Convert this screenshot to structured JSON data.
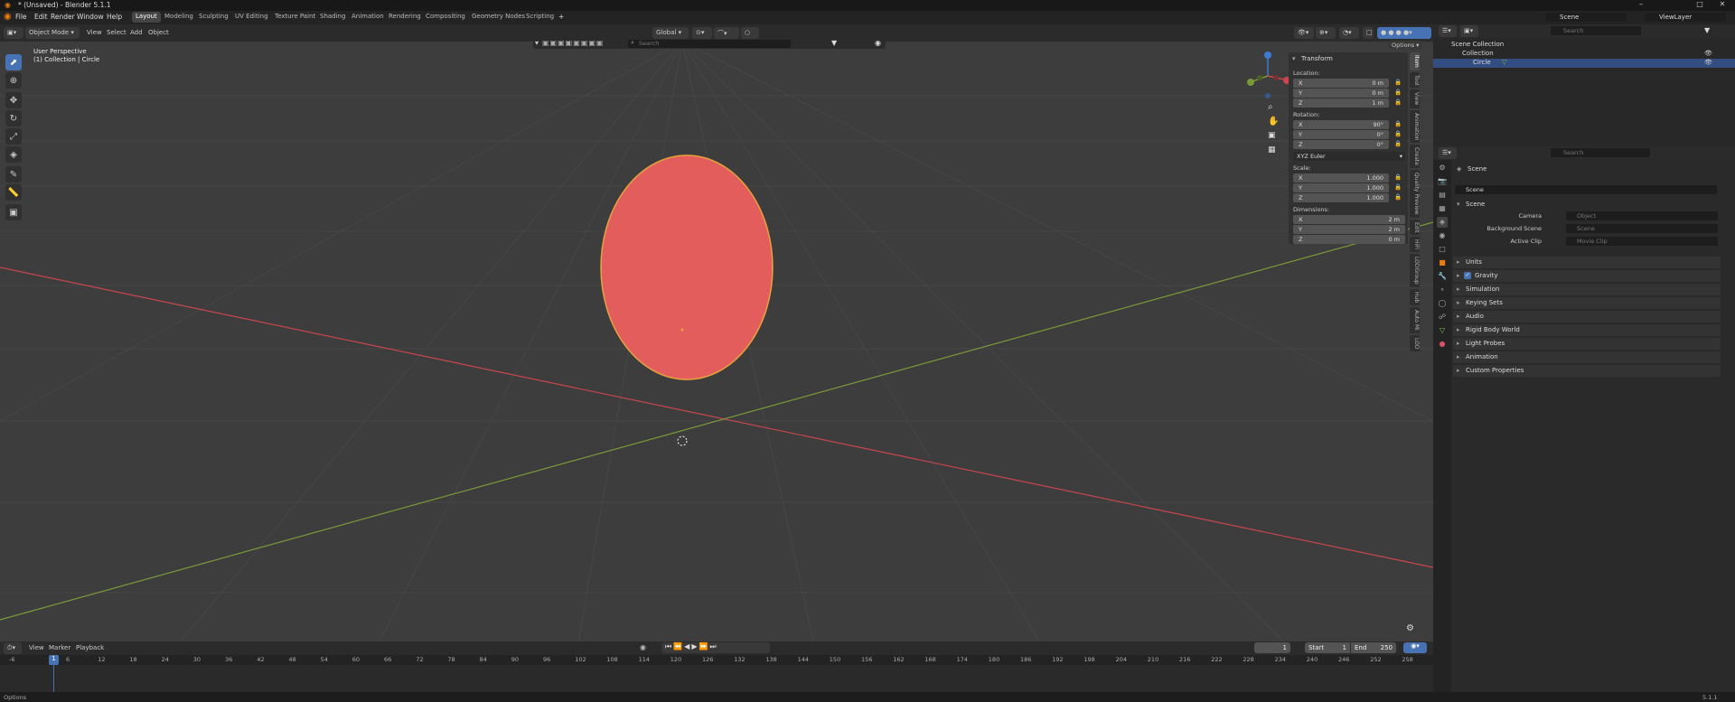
{
  "window": {
    "title": "* (Unsaved) - Blender 5.1.1",
    "controls": [
      "–",
      "□",
      "✕"
    ]
  },
  "menus": [
    "File",
    "Edit",
    "Render",
    "Window",
    "Help"
  ],
  "workspaces": [
    "Layout",
    "Modeling",
    "Sculpting",
    "UV Editing",
    "Texture Paint",
    "Shading",
    "Animation",
    "Rendering",
    "Compositing",
    "Geometry Nodes",
    "Scripting"
  ],
  "add_workspace": "+",
  "scene_field": "Scene",
  "viewlayer_field": "ViewLayer",
  "viewport_header": {
    "mode": "Object Mode",
    "menus": [
      "View",
      "Select",
      "Add",
      "Object"
    ],
    "orientation": "Global",
    "search_placeholder": "Search",
    "options": "Options"
  },
  "viewport": {
    "perspective": "User Perspective",
    "collection_path": "(1) Collection | Circle",
    "circle_color": "#e35d5d",
    "outline_color": "#e9a23b",
    "x_axis_color": "#c9464e",
    "y_axis_color": "#7a9a3a"
  },
  "transform": {
    "title": "Transform",
    "location_label": "Location:",
    "location": [
      {
        "axis": "X",
        "value": "0 m"
      },
      {
        "axis": "Y",
        "value": "0 m"
      },
      {
        "axis": "Z",
        "value": "1 m"
      }
    ],
    "rotation_label": "Rotation:",
    "rotation": [
      {
        "axis": "X",
        "value": "90°"
      },
      {
        "axis": "Y",
        "value": "0°"
      },
      {
        "axis": "Z",
        "value": "0°"
      }
    ],
    "rotation_mode": "XYZ Euler",
    "scale_label": "Scale:",
    "scale": [
      {
        "axis": "X",
        "value": "1.000"
      },
      {
        "axis": "Y",
        "value": "1.000"
      },
      {
        "axis": "Z",
        "value": "1.000"
      }
    ],
    "dimensions_label": "Dimensions:",
    "dimensions": [
      {
        "axis": "X",
        "value": "2 m"
      },
      {
        "axis": "Y",
        "value": "2 m"
      },
      {
        "axis": "Z",
        "value": "0 m"
      }
    ]
  },
  "side_tabs": [
    "Item",
    "Tool",
    "View",
    "Animation",
    "Create",
    "Quality Preview",
    "Edit",
    "HiFi",
    "LODGroup",
    "Hub",
    "Auto Mi",
    "LOD"
  ],
  "timeline": {
    "menus": [
      "View",
      "Marker",
      "Playback"
    ],
    "current_frame": "1",
    "start_label": "Start",
    "start": "1",
    "end_label": "End",
    "end": "250",
    "ruler": [
      "-6",
      "1",
      "6",
      "12",
      "18",
      "24",
      "30",
      "36",
      "42",
      "48",
      "54",
      "60",
      "66",
      "72",
      "78",
      "84",
      "90",
      "96",
      "102",
      "108",
      "114",
      "120",
      "126",
      "132",
      "138",
      "144",
      "150",
      "156",
      "162",
      "168",
      "174",
      "180",
      "186",
      "192",
      "198",
      "204",
      "210",
      "216",
      "222",
      "228",
      "234",
      "240",
      "246",
      "252",
      "258"
    ]
  },
  "outliner": {
    "search_placeholder": "Search",
    "items": [
      "Scene Collection",
      "Collection",
      "Circle"
    ]
  },
  "properties": {
    "search_placeholder": "Search",
    "breadcrumb": "Scene",
    "scene_name": "Scene",
    "section_scene": "Scene",
    "camera_label": "Camera",
    "camera_placeholder": "Object",
    "background_label": "Background Scene",
    "background_placeholder": "Scene",
    "clip_label": "Active Clip",
    "clip_placeholder": "Movie Clip",
    "sections": [
      "Units",
      "Gravity",
      "Simulation",
      "Keying Sets",
      "Audio",
      "Rigid Body World",
      "Light Probes",
      "Animation",
      "Custom Properties"
    ]
  },
  "status": {
    "left": "Options",
    "version": "5.1.1"
  }
}
